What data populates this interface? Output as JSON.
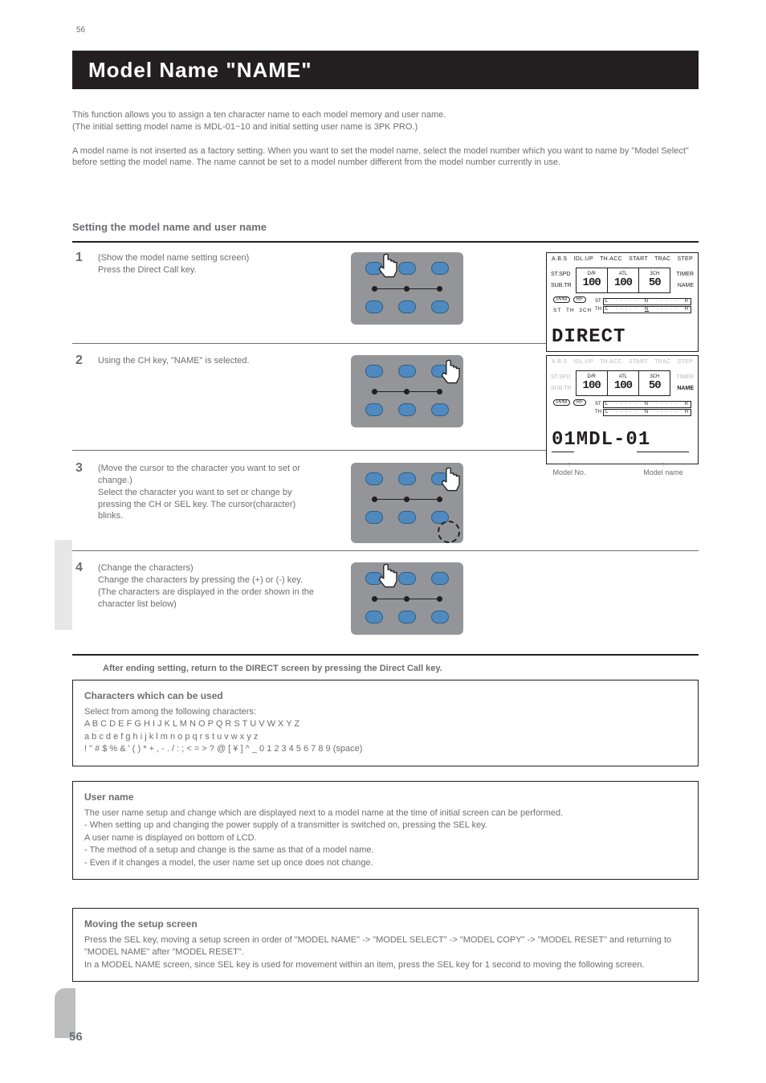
{
  "page_number_top": "56",
  "header_title": "Model Name \"NAME\"",
  "intro_p1": "This function allows you to assign a ten character name to each model memory and user name.",
  "intro_p2": "(The initial setting model name is MDL-01~10 and initial setting user name is 3PK PRO.)",
  "intro_p3": "A model name is not inserted as a factory setting. When you want to set the model name, select the model number which you want to name by \"Model Select\" before setting the model name. The name cannot be set to a model number different from the model number currently in use.",
  "steps_header": "Setting the model name and user name",
  "steps": [
    {
      "num": "1",
      "text_a": "(Show the model name setting screen)",
      "text_b": "Press the Direct Call key."
    },
    {
      "num": "2",
      "text_a": "Using the CH key, \"NAME\" is selected.",
      "text_b": ""
    },
    {
      "num": "3",
      "text_a": "(Move the cursor to the character you want to set or change.)",
      "text_b": "Select the character you want to set or change by pressing the CH or SEL key. The cursor(character) blinks."
    },
    {
      "num": "4",
      "text_a": "(Change the characters)",
      "text_b": "Change the characters by pressing the (+) or (-) key.",
      "text_c": "(The characters are displayed in the order shown in the character list below)"
    }
  ],
  "return_line": "After ending setting, return to the DIRECT screen by pressing the Direct Call key.",
  "box1_title": "Characters which can be used",
  "box1_body": "Select from among the following characters:\nA B C D E F G H I J K L M N O P Q R S T U V W X Y Z\na b c d e f g h i j k l m n o p q r s t u v w x y z\n! \" # $ % & ' ( ) * + , - . / : ; < = > ? @ [ ¥ ] ^ _ 0 1 2 3 4 5 6 7 8 9 (space)",
  "box2_title": "User name",
  "box2_body": "The user name setup and change which are displayed next to a model name at the time of initial screen can be performed.\n- When setting up and changing the power supply of a transmitter is switched on, pressing the SEL key.\nA user name is displayed on bottom of LCD.\n- The method of a setup and change is the same as that of a model name.\n- Even if it changes a model, the user name set up once does not change.",
  "box3_title": "Moving the setup screen",
  "box3_body": "Press the SEL key, moving a setup screen in order of \"MODEL NAME\" -> \"MODEL SELECT\" -> \"MODEL COPY\" -> \"MODEL RESET\" and returning to \"MODEL NAME\" after \"MODEL RESET\".\nIn a MODEL NAME screen, since SEL key is used for movement within an item, press the SEL key for 1 second to moving the following screen.",
  "lcd1": {
    "toprow": [
      "A.B.S",
      "IDL.UP",
      "TH.ACC",
      "START",
      "TRAC",
      "STEP"
    ],
    "left": [
      "ST.SPD",
      "SUB.TR"
    ],
    "right": [
      "TIMER",
      "NAME"
    ],
    "cells": [
      {
        "h": "D/R",
        "v": "100"
      },
      {
        "h": "ATL",
        "v": "100"
      },
      {
        "h": "3CH",
        "v": "50"
      }
    ],
    "ppm": "PPM",
    "rf": "RF",
    "st": "ST",
    "th": "TH",
    "tch": "3CH",
    "bar_labels": [
      "ST",
      "TH"
    ],
    "bar_scale": [
      "L",
      "N",
      "R",
      "H"
    ],
    "bottom": "DIRECT"
  },
  "lcd2": {
    "bottom": "01MDL-01",
    "arrow_model_no": "Model No.",
    "arrow_model_name": "Model name"
  },
  "page_foot": "56"
}
